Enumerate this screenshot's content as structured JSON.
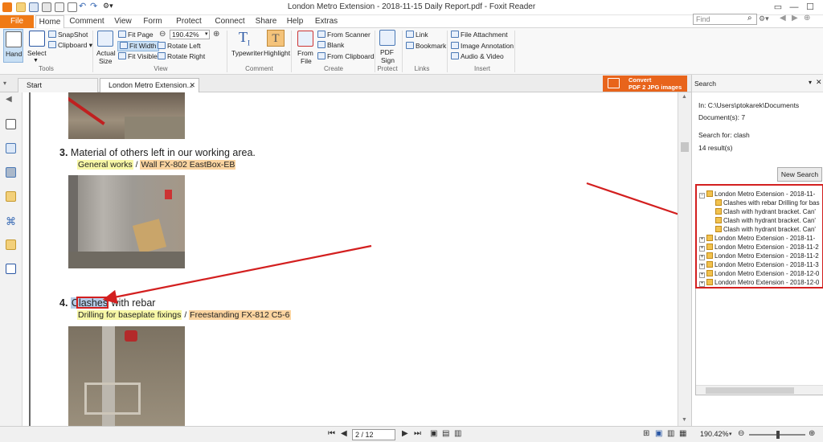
{
  "window": {
    "title": "London Metro Extension - 2018-11-15 Daily Report.pdf - Foxit Reader"
  },
  "menu": {
    "tabs": [
      "File",
      "Home",
      "Comment",
      "View",
      "Form",
      "Protect",
      "Connect",
      "Share",
      "Help",
      "Extras"
    ]
  },
  "find": {
    "placeholder": "Find"
  },
  "ribbon": {
    "tools": {
      "hand": "Hand",
      "select": "Select",
      "snapshot": "SnapShot",
      "clipboard": "Clipboard",
      "label": "Tools"
    },
    "view": {
      "actual": "Actual",
      "size": "Size",
      "fit_page": "Fit Page",
      "fit_width": "Fit Width",
      "fit_visible": "Fit Visible",
      "zoom": "190.42%",
      "rotate_left": "Rotate Left",
      "rotate_right": "Rotate Right",
      "label": "View"
    },
    "comment": {
      "typewriter": "Typewriter",
      "highlight": "Highlight",
      "label": "Comment"
    },
    "create": {
      "from": "From",
      "file": "File",
      "from_scanner": "From Scanner",
      "blank": "Blank",
      "from_clipboard": "From Clipboard",
      "label": "Create"
    },
    "protect": {
      "pdf": "PDF",
      "sign": "Sign",
      "label": "Protect"
    },
    "links": {
      "link": "Link",
      "bookmark": "Bookmark",
      "label": "Links"
    },
    "insert": {
      "file_attachment": "File Attachment",
      "image_annotation": "Image Annotation",
      "audio_video": "Audio & Video",
      "label": "Insert"
    }
  },
  "doc_tabs": [
    "Start",
    "London Metro Extension..."
  ],
  "convert": {
    "line1": "Convert",
    "line2": "PDF 2 JPG images"
  },
  "document": {
    "item3": {
      "num": "3.",
      "text": "Material of others left in our working area.",
      "tag1": "General works",
      "sep": "/",
      "tag2": "Wall FX-802 EastBox-EB"
    },
    "item4": {
      "num": "4.",
      "highlight": "Clashes",
      "text": " with rebar",
      "tag1": "Drilling for baseplate fixings",
      "sep": "/",
      "tag2": "Freestanding FX-812 C5-6"
    }
  },
  "search": {
    "title": "Search",
    "in": "In: C:\\Users\\ptokarek\\Documents",
    "documents": "Document(s): 7",
    "search_for": "Search for: clash",
    "results_count": "14 result(s)",
    "new_search": "New Search",
    "results": [
      {
        "level": 0,
        "text": "London Metro Extension -  2018-11-",
        "expanded": true
      },
      {
        "level": 1,
        "text": "Clashes with rebar Drilling for bas"
      },
      {
        "level": 1,
        "text": "Clash with hydrant bracket. Can'"
      },
      {
        "level": 1,
        "text": "Clash with hydrant bracket. Can'"
      },
      {
        "level": 1,
        "text": "Clash with hydrant bracket. Can'"
      },
      {
        "level": 0,
        "text": "London Metro Extension -  2018-11-"
      },
      {
        "level": 0,
        "text": "London Metro Extension - 2018-11-2"
      },
      {
        "level": 0,
        "text": "London Metro Extension - 2018-11-2"
      },
      {
        "level": 0,
        "text": "London Metro Extension - 2018-11-3"
      },
      {
        "level": 0,
        "text": "London Metro Extension - 2018-12-0"
      },
      {
        "level": 0,
        "text": "London Metro Extension - 2018-12-0"
      }
    ]
  },
  "status": {
    "page": "2 / 12",
    "zoom": "190.42%"
  },
  "colors": {
    "accent": "#f07a16",
    "annotation": "#d31f1f"
  }
}
